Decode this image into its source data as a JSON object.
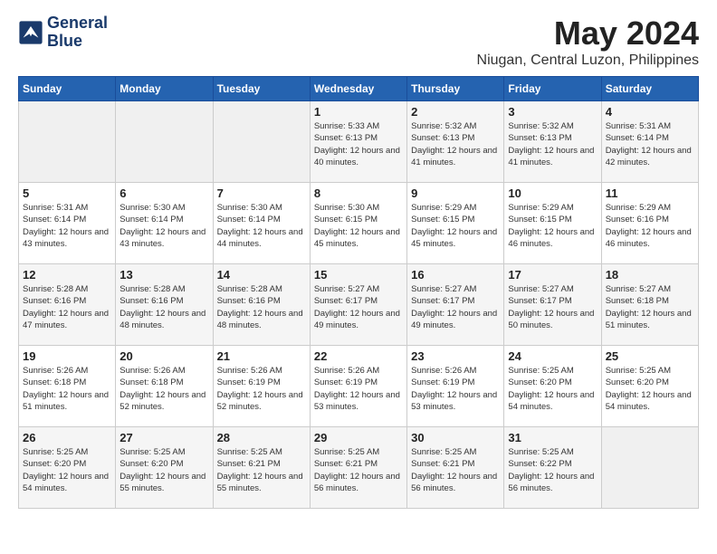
{
  "logo": {
    "line1": "General",
    "line2": "Blue"
  },
  "title": "May 2024",
  "subtitle": "Niugan, Central Luzon, Philippines",
  "days_of_week": [
    "Sunday",
    "Monday",
    "Tuesday",
    "Wednesday",
    "Thursday",
    "Friday",
    "Saturday"
  ],
  "weeks": [
    [
      {
        "day": "",
        "info": ""
      },
      {
        "day": "",
        "info": ""
      },
      {
        "day": "",
        "info": ""
      },
      {
        "day": "1",
        "info": "Sunrise: 5:33 AM\nSunset: 6:13 PM\nDaylight: 12 hours\nand 40 minutes."
      },
      {
        "day": "2",
        "info": "Sunrise: 5:32 AM\nSunset: 6:13 PM\nDaylight: 12 hours\nand 41 minutes."
      },
      {
        "day": "3",
        "info": "Sunrise: 5:32 AM\nSunset: 6:13 PM\nDaylight: 12 hours\nand 41 minutes."
      },
      {
        "day": "4",
        "info": "Sunrise: 5:31 AM\nSunset: 6:14 PM\nDaylight: 12 hours\nand 42 minutes."
      }
    ],
    [
      {
        "day": "5",
        "info": "Sunrise: 5:31 AM\nSunset: 6:14 PM\nDaylight: 12 hours\nand 43 minutes."
      },
      {
        "day": "6",
        "info": "Sunrise: 5:30 AM\nSunset: 6:14 PM\nDaylight: 12 hours\nand 43 minutes."
      },
      {
        "day": "7",
        "info": "Sunrise: 5:30 AM\nSunset: 6:14 PM\nDaylight: 12 hours\nand 44 minutes."
      },
      {
        "day": "8",
        "info": "Sunrise: 5:30 AM\nSunset: 6:15 PM\nDaylight: 12 hours\nand 45 minutes."
      },
      {
        "day": "9",
        "info": "Sunrise: 5:29 AM\nSunset: 6:15 PM\nDaylight: 12 hours\nand 45 minutes."
      },
      {
        "day": "10",
        "info": "Sunrise: 5:29 AM\nSunset: 6:15 PM\nDaylight: 12 hours\nand 46 minutes."
      },
      {
        "day": "11",
        "info": "Sunrise: 5:29 AM\nSunset: 6:16 PM\nDaylight: 12 hours\nand 46 minutes."
      }
    ],
    [
      {
        "day": "12",
        "info": "Sunrise: 5:28 AM\nSunset: 6:16 PM\nDaylight: 12 hours\nand 47 minutes."
      },
      {
        "day": "13",
        "info": "Sunrise: 5:28 AM\nSunset: 6:16 PM\nDaylight: 12 hours\nand 48 minutes."
      },
      {
        "day": "14",
        "info": "Sunrise: 5:28 AM\nSunset: 6:16 PM\nDaylight: 12 hours\nand 48 minutes."
      },
      {
        "day": "15",
        "info": "Sunrise: 5:27 AM\nSunset: 6:17 PM\nDaylight: 12 hours\nand 49 minutes."
      },
      {
        "day": "16",
        "info": "Sunrise: 5:27 AM\nSunset: 6:17 PM\nDaylight: 12 hours\nand 49 minutes."
      },
      {
        "day": "17",
        "info": "Sunrise: 5:27 AM\nSunset: 6:17 PM\nDaylight: 12 hours\nand 50 minutes."
      },
      {
        "day": "18",
        "info": "Sunrise: 5:27 AM\nSunset: 6:18 PM\nDaylight: 12 hours\nand 51 minutes."
      }
    ],
    [
      {
        "day": "19",
        "info": "Sunrise: 5:26 AM\nSunset: 6:18 PM\nDaylight: 12 hours\nand 51 minutes."
      },
      {
        "day": "20",
        "info": "Sunrise: 5:26 AM\nSunset: 6:18 PM\nDaylight: 12 hours\nand 52 minutes."
      },
      {
        "day": "21",
        "info": "Sunrise: 5:26 AM\nSunset: 6:19 PM\nDaylight: 12 hours\nand 52 minutes."
      },
      {
        "day": "22",
        "info": "Sunrise: 5:26 AM\nSunset: 6:19 PM\nDaylight: 12 hours\nand 53 minutes."
      },
      {
        "day": "23",
        "info": "Sunrise: 5:26 AM\nSunset: 6:19 PM\nDaylight: 12 hours\nand 53 minutes."
      },
      {
        "day": "24",
        "info": "Sunrise: 5:25 AM\nSunset: 6:20 PM\nDaylight: 12 hours\nand 54 minutes."
      },
      {
        "day": "25",
        "info": "Sunrise: 5:25 AM\nSunset: 6:20 PM\nDaylight: 12 hours\nand 54 minutes."
      }
    ],
    [
      {
        "day": "26",
        "info": "Sunrise: 5:25 AM\nSunset: 6:20 PM\nDaylight: 12 hours\nand 54 minutes."
      },
      {
        "day": "27",
        "info": "Sunrise: 5:25 AM\nSunset: 6:20 PM\nDaylight: 12 hours\nand 55 minutes."
      },
      {
        "day": "28",
        "info": "Sunrise: 5:25 AM\nSunset: 6:21 PM\nDaylight: 12 hours\nand 55 minutes."
      },
      {
        "day": "29",
        "info": "Sunrise: 5:25 AM\nSunset: 6:21 PM\nDaylight: 12 hours\nand 56 minutes."
      },
      {
        "day": "30",
        "info": "Sunrise: 5:25 AM\nSunset: 6:21 PM\nDaylight: 12 hours\nand 56 minutes."
      },
      {
        "day": "31",
        "info": "Sunrise: 5:25 AM\nSunset: 6:22 PM\nDaylight: 12 hours\nand 56 minutes."
      },
      {
        "day": "",
        "info": ""
      }
    ]
  ]
}
